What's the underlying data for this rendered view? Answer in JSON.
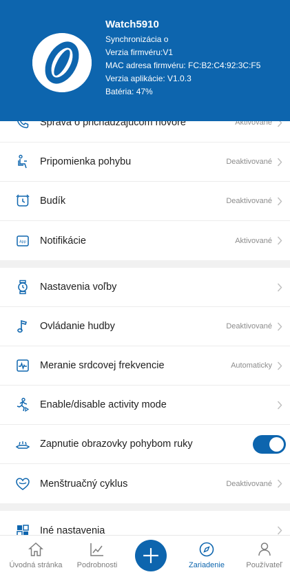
{
  "device": {
    "name": "Watch5910",
    "sync": "Synchronizácia o",
    "firmware": "Verzia firmvéru:V1",
    "mac": "MAC adresa firmvéru: FC:B2:C4:92:3C:F5",
    "app_version": "Verzia aplikácie: V1.0.3",
    "battery": "Batéria: 47%"
  },
  "settings": {
    "incoming_call": {
      "label": "Správa o prichádzajúcom hovore",
      "value": "Aktivované",
      "icon": "phone-icon"
    },
    "move_reminder": {
      "label": "Pripomienka pohybu",
      "value": "Deaktivované",
      "icon": "seat-icon"
    },
    "alarm": {
      "label": "Budík",
      "value": "Deaktivované",
      "icon": "alarm-clock-icon"
    },
    "notifications": {
      "label": "Notifikácie",
      "value": "Aktivované",
      "icon": "app-icon"
    },
    "choice_settings": {
      "label": "Nastavenia voľby",
      "value": "",
      "icon": "watch-icon"
    },
    "music_control": {
      "label": "Ovládanie hudby",
      "value": "Deaktivované",
      "icon": "music-note-icon"
    },
    "heart_rate": {
      "label": "Meranie srdcovej frekvencie",
      "value": "Automaticky",
      "icon": "heart-rate-icon"
    },
    "activity_mode": {
      "label": "Enable/disable activity mode",
      "value": "",
      "icon": "running-icon"
    },
    "raise_to_wake": {
      "label": "Zapnutie obrazovky pohybom ruky",
      "enabled": true,
      "icon": "wrist-screen-icon"
    },
    "menstrual_cycle": {
      "label": "Menštruačný cyklus",
      "value": "Deaktivované",
      "icon": "heart-outline-icon"
    },
    "other_settings": {
      "label": "Iné nastavenia",
      "value": "",
      "icon": "grid-icon"
    }
  },
  "tabbar": {
    "home": "Úvodná stránka",
    "details": "Podrobnosti",
    "device": "Zariadenie",
    "user": "Používateľ",
    "active": "device"
  },
  "colors": {
    "primary": "#0d65ae",
    "header_bg": "#0d65ae",
    "muted_text": "#8c8c8c"
  }
}
